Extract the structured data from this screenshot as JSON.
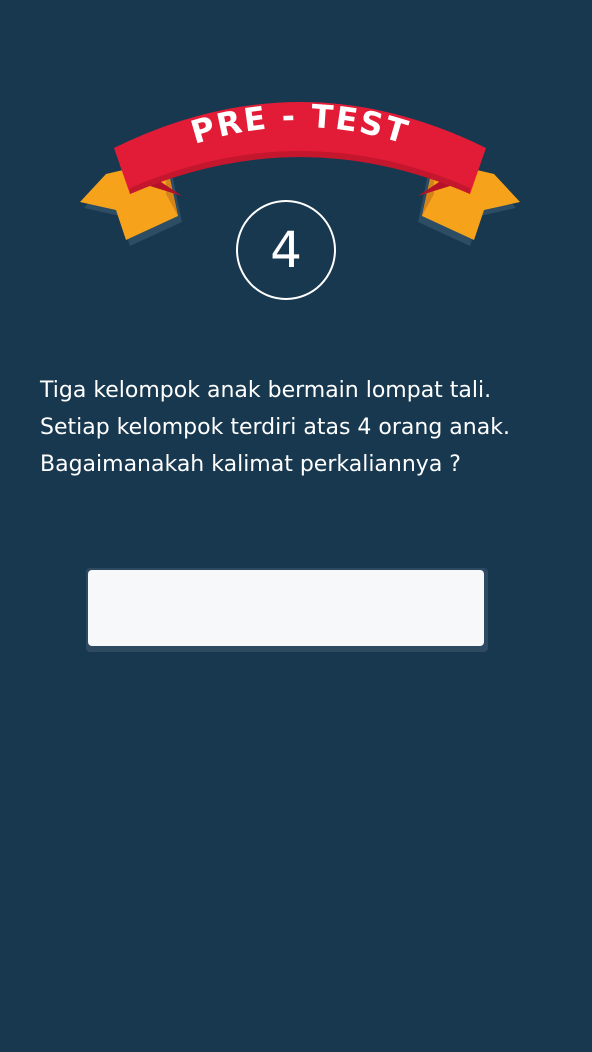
{
  "banner": {
    "title": "PRE - TEST",
    "ribbon_color": "#e21c36",
    "tail_color": "#f7a21b"
  },
  "question_number": "4",
  "question": {
    "lines": [
      "Tiga kelompok anak bermain lompat tali.",
      "Setiap kelompok terdiri atas 4 orang anak.",
      "Bagaimanakah kalimat perkaliannya ?"
    ]
  },
  "answer": {
    "value": "",
    "placeholder": ""
  },
  "colors": {
    "background": "#18384f",
    "text": "#ffffff",
    "input_background": "#f6f8fa"
  }
}
